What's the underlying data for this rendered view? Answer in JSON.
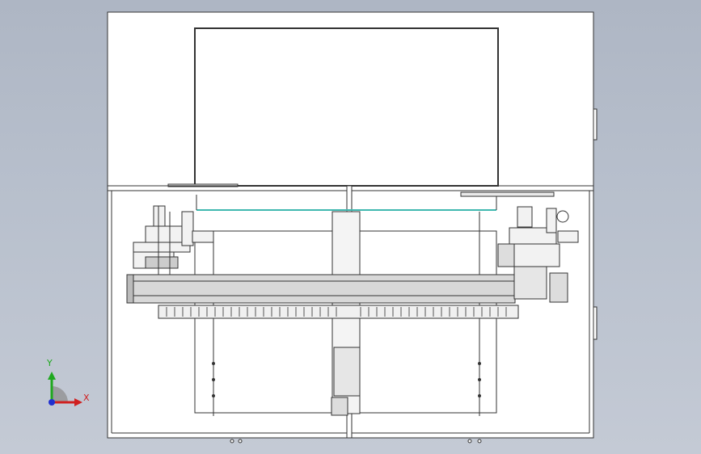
{
  "triad": {
    "x_label": "X",
    "y_label": "Y",
    "colors": {
      "x": "#d02020",
      "y": "#1fa81f",
      "z": "#2030d0"
    }
  },
  "drawing": {
    "line_color": "#333333",
    "frame_fill": "#ffffff",
    "rail_fill": "#d8d8d8",
    "glass_edge": "#40b8b0"
  }
}
